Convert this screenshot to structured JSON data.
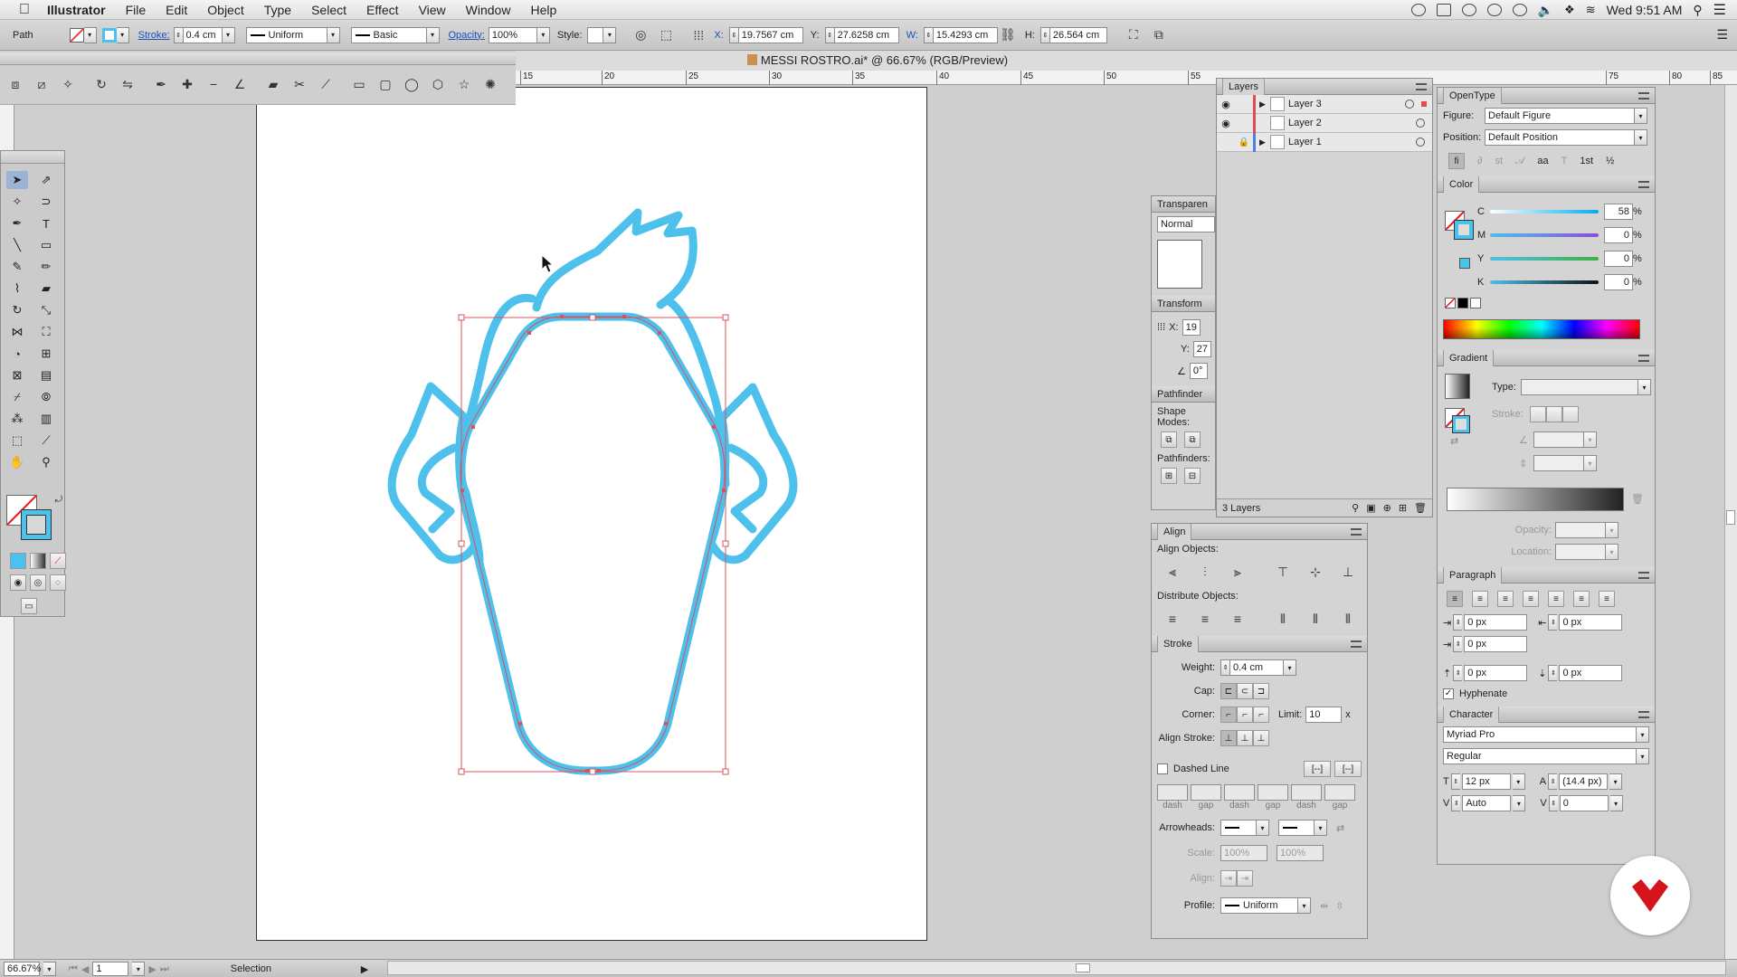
{
  "menubar": {
    "app": "Illustrator",
    "items": [
      "File",
      "Edit",
      "Object",
      "Type",
      "Select",
      "Effect",
      "View",
      "Window",
      "Help"
    ],
    "clock": "Wed 9:51 AM"
  },
  "controlbar": {
    "selection_type": "Path",
    "stroke_label": "Stroke:",
    "stroke_weight": "0.4 cm",
    "stroke_profile": "Uniform",
    "brush": "Basic",
    "opacity_label": "Opacity:",
    "opacity": "100%",
    "style_label": "Style:",
    "x_label": "X:",
    "x": "19.7567 cm",
    "y_label": "Y:",
    "y": "27.6258 cm",
    "w_label": "W:",
    "w": "15.4293 cm",
    "h_label": "H:",
    "h": "26.564 cm"
  },
  "document": {
    "title": "MESSI ROSTRO.ai* @ 66.67% (RGB/Preview)"
  },
  "ruler": {
    "marks": [
      "15",
      "20",
      "25",
      "30",
      "35",
      "40",
      "45",
      "50",
      "55",
      "75",
      "80",
      "85"
    ]
  },
  "layers_panel": {
    "tab": "Layers",
    "layers": [
      {
        "name": "Layer 3",
        "visible": true,
        "locked": false
      },
      {
        "name": "Layer 2",
        "visible": true,
        "locked": false
      },
      {
        "name": "Layer 1",
        "visible": false,
        "locked": true
      }
    ],
    "count": "3 Layers"
  },
  "opentype_panel": {
    "tab": "OpenType",
    "figure_label": "Figure:",
    "figure": "Default Figure",
    "position_label": "Position:",
    "position": "Default Position"
  },
  "color_panel": {
    "tab": "Color",
    "channels": [
      {
        "label": "C",
        "value": "58",
        "unit": "%"
      },
      {
        "label": "M",
        "value": "0",
        "unit": "%"
      },
      {
        "label": "Y",
        "value": "0",
        "unit": "%"
      },
      {
        "label": "K",
        "value": "0",
        "unit": "%"
      }
    ]
  },
  "gradient_panel": {
    "tab": "Gradient",
    "type_label": "Type:",
    "stroke_label": "Stroke:",
    "opacity_label": "Opacity:",
    "location_label": "Location:"
  },
  "paragraph_panel": {
    "tab": "Paragraph",
    "left_indent": "0 px",
    "right_indent": "0 px",
    "first_indent": "0 px",
    "space_before": "0 px",
    "space_after": "0 px",
    "hyphenate": "Hyphenate"
  },
  "character_panel": {
    "tab": "Character",
    "font": "Myriad Pro",
    "style": "Regular",
    "size": "12 px",
    "leading": "(14.4 px)",
    "kerning": "Auto",
    "tracking": "0"
  },
  "transparency_panel": {
    "tab": "Transparen",
    "mode": "Normal"
  },
  "transform_panel": {
    "tab": "Transform",
    "x_label": "X:",
    "x": "19",
    "y_label": "Y:",
    "y": "27",
    "angle": "0°"
  },
  "pathfinder_panel": {
    "tab": "Pathfinder",
    "shape_modes": "Shape Modes:",
    "pathfinders": "Pathfinders:"
  },
  "align_panel": {
    "tab": "Align",
    "align_objects": "Align Objects:",
    "distribute_objects": "Distribute Objects:"
  },
  "stroke_panel": {
    "tab": "Stroke",
    "weight_label": "Weight:",
    "weight": "0.4 cm",
    "cap_label": "Cap:",
    "corner_label": "Corner:",
    "limit_label": "Limit:",
    "limit": "10",
    "limit_unit": "x",
    "align_label": "Align Stroke:",
    "dashed": "Dashed Line",
    "dash_labels": [
      "dash",
      "gap",
      "dash",
      "gap",
      "dash",
      "gap"
    ],
    "arrowheads_label": "Arrowheads:",
    "scale_label": "Scale:",
    "scale1": "100%",
    "scale2": "100%",
    "align2_label": "Align:",
    "profile_label": "Profile:",
    "profile": "Uniform"
  },
  "statusbar": {
    "zoom": "66.67%",
    "page": "1",
    "tool": "Selection"
  },
  "colors": {
    "stroke_blue": "#4ec0ec",
    "selection": "#d9535f",
    "accent": "#1c4fb8"
  }
}
